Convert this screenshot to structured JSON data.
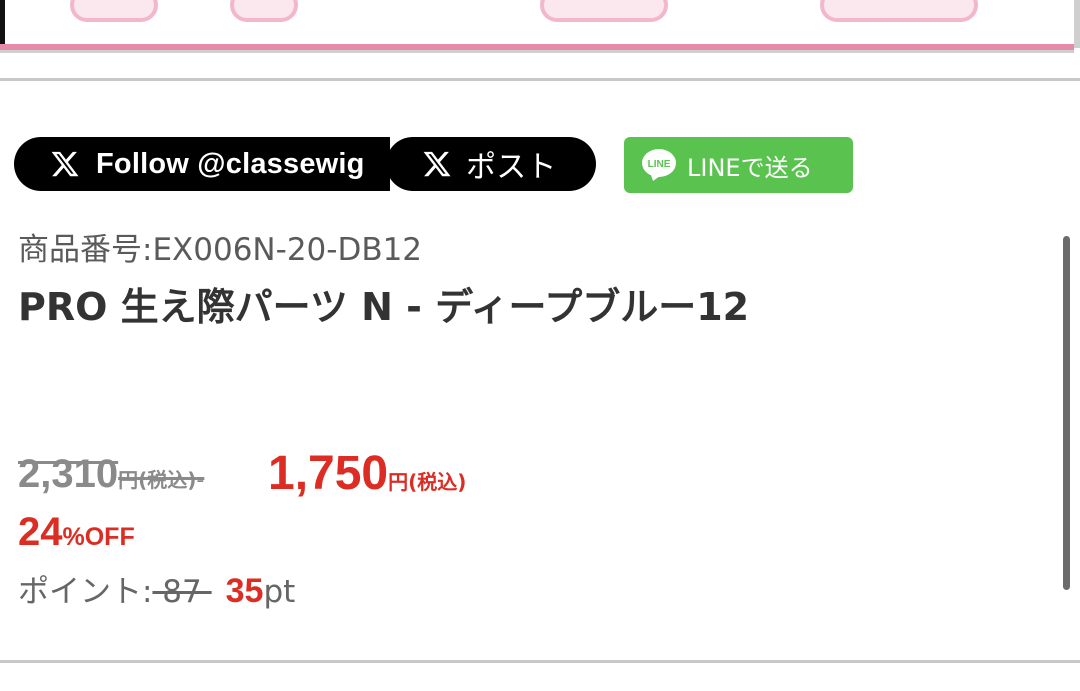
{
  "share": {
    "x_follow_label": "Follow @classewig",
    "x_post_label": "ポスト",
    "line_label": "LINEで送る",
    "line_icon_text": "LINE"
  },
  "product": {
    "code_label": "商品番号:EX006N-20-DB12",
    "title": "PRO 生え際パーツ N - ディープブルー12"
  },
  "price": {
    "old_value": "2,310",
    "old_unit": "円(税込)",
    "old_tail": "-",
    "new_value": "1,750",
    "new_unit": "円(税込)",
    "discount_value": "24",
    "discount_suffix": "%OFF"
  },
  "points": {
    "label": "ポイント:",
    "old_value": " 87 ",
    "new_value": "35",
    "unit": "pt"
  },
  "colors": {
    "accent_red": "#dc2d24",
    "line_green": "#5ac350",
    "x_black": "#000000",
    "banner_pink": "#e58aa8"
  },
  "icons": [
    "x-logo-icon",
    "line-logo-icon"
  ]
}
